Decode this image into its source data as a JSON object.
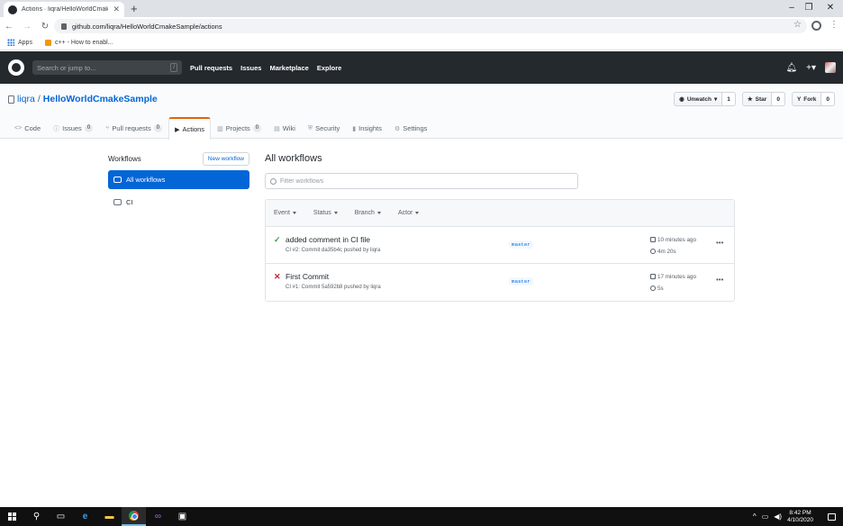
{
  "browser": {
    "tab_title": "Actions · liqra/HelloWorldCmakeSample",
    "url": "github.com/liqra/HelloWorldCmakeSample/actions",
    "bookmarks": [
      {
        "label": "Apps"
      },
      {
        "label": "c++ - How to enabl..."
      }
    ]
  },
  "gh_header": {
    "search_placeholder": "Search or jump to...",
    "search_key": "/",
    "nav": [
      "Pull requests",
      "Issues",
      "Marketplace",
      "Explore"
    ]
  },
  "repo": {
    "owner": "liqra",
    "separator": "/",
    "name": "HelloWorldCmakeSample",
    "watch_label": "Unwatch",
    "watch_count": "1",
    "star_label": "Star",
    "star_count": "0",
    "fork_label": "Fork",
    "fork_count": "0",
    "nav": [
      {
        "label": "Code",
        "icon": "<>",
        "count": ""
      },
      {
        "label": "Issues",
        "icon": "ⓘ",
        "count": "0"
      },
      {
        "label": "Pull requests",
        "icon": "⑂",
        "count": "0"
      },
      {
        "label": "Actions",
        "icon": "▶",
        "count": "",
        "selected": true
      },
      {
        "label": "Projects",
        "icon": "▥",
        "count": "0"
      },
      {
        "label": "Wiki",
        "icon": "▤",
        "count": ""
      },
      {
        "label": "Security",
        "icon": "⛨",
        "count": ""
      },
      {
        "label": "Insights",
        "icon": "▮",
        "count": ""
      },
      {
        "label": "Settings",
        "icon": "⚙",
        "count": ""
      }
    ]
  },
  "sidebar": {
    "title": "Workflows",
    "new_workflow": "New workflow",
    "items": [
      {
        "label": "All workflows"
      },
      {
        "label": "CI"
      }
    ]
  },
  "main": {
    "title": "All workflows",
    "filter_placeholder": "Filter workflows",
    "filters": [
      "Event",
      "Status",
      "Branch",
      "Actor"
    ],
    "runs": [
      {
        "status": "success",
        "status_icon": "✓",
        "status_color": "#28a745",
        "title": "added comment in CI file",
        "meta": "CI #2: Commit da35b4c pushed by liqra",
        "branch": "master",
        "time": "10 minutes ago",
        "duration": "4m 20s"
      },
      {
        "status": "failure",
        "status_icon": "✕",
        "status_color": "#cb2431",
        "title": "First Commit",
        "meta": "CI #1: Commit 5a592b8 pushed by liqra",
        "branch": "master",
        "time": "17 minutes ago",
        "duration": "5s"
      }
    ]
  },
  "taskbar": {
    "time": "8:42 PM",
    "date": "4/10/2020"
  }
}
